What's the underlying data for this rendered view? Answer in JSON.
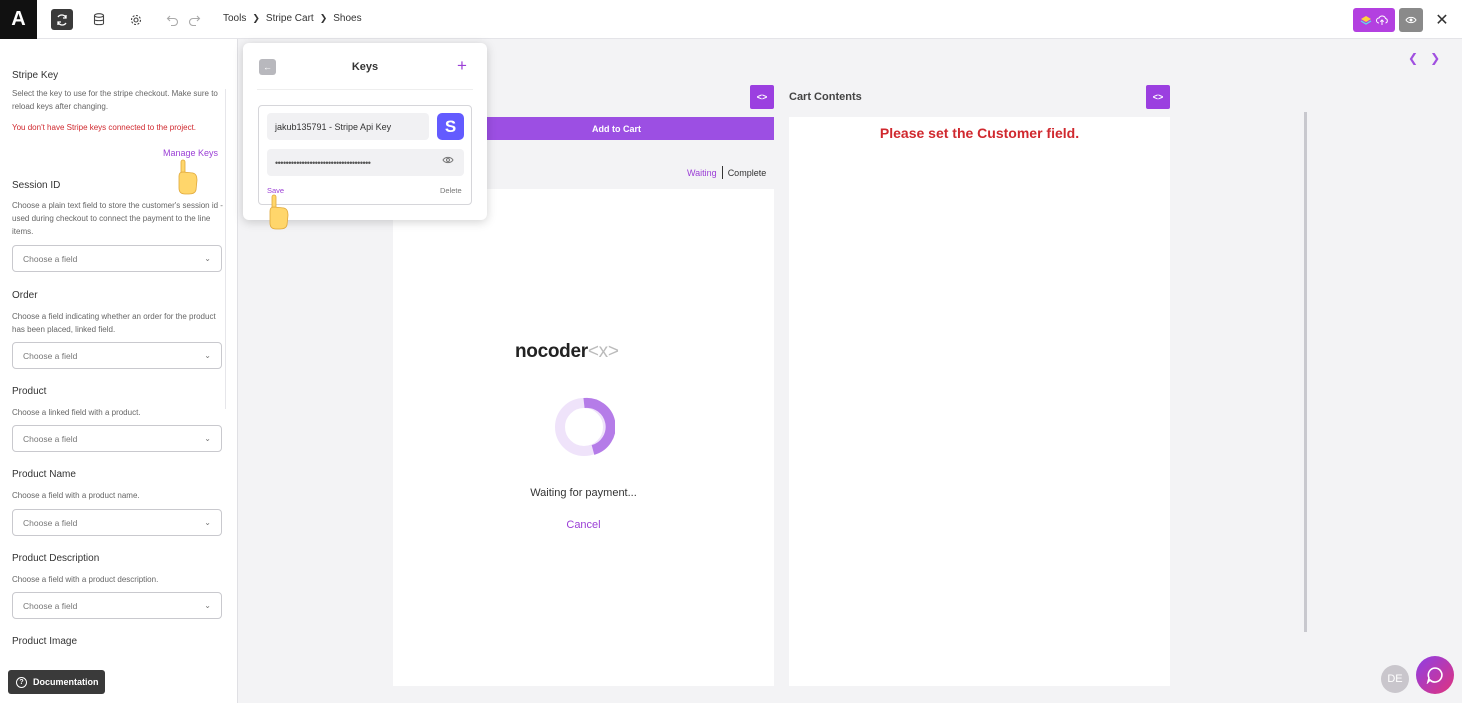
{
  "topbar": {
    "logo": "A",
    "breadcrumb": [
      "Tools",
      "Stripe Cart",
      "Shoes"
    ]
  },
  "sidebar": {
    "stripe_key": {
      "title": "Stripe Key",
      "desc": "Select the key to use for the stripe checkout. Make sure to reload keys after changing.",
      "error": "You don't have Stripe keys connected to the project.",
      "manage_keys": "Manage Keys"
    },
    "session_id": {
      "title": "Session ID",
      "desc": "Choose a plain text field to store the customer's session id - used during checkout to connect the payment to the line items.",
      "placeholder": "Choose a field"
    },
    "order": {
      "title": "Order",
      "desc": "Choose a field indicating whether an order for the product has been placed, linked field.",
      "placeholder": "Choose a field"
    },
    "product": {
      "title": "Product",
      "desc": "Choose a linked field with a product.",
      "placeholder": "Choose a field"
    },
    "product_name": {
      "title": "Product Name",
      "desc": "Choose a field with a product name.",
      "placeholder": "Choose a field"
    },
    "product_description": {
      "title": "Product Description",
      "desc": "Choose a field with a product description.",
      "placeholder": "Choose a field"
    },
    "product_image": {
      "title": "Product Image"
    },
    "documentation": "Documentation"
  },
  "canvas": {
    "add_to_cart": "Add to Cart",
    "status_waiting": "Waiting",
    "status_complete": "Complete",
    "brand": "nocoder",
    "brand_tag": "<x>",
    "waiting_text": "Waiting for payment...",
    "cancel": "Cancel",
    "cart_title": "Cart Contents",
    "cart_message": "Please set the Customer field.",
    "code_tag": "<>"
  },
  "keys_popover": {
    "title": "Keys",
    "key_name": "jakub135791 - Stripe Api Key",
    "key_secret": "••••••••••••••••••••••••••••••••••••",
    "stripe_badge": "S",
    "save": "Save",
    "delete": "Delete"
  },
  "user": {
    "initials": "DE"
  },
  "colors": {
    "accent": "#9b3fd6",
    "error": "#d0282e",
    "stripe": "#635bff"
  }
}
